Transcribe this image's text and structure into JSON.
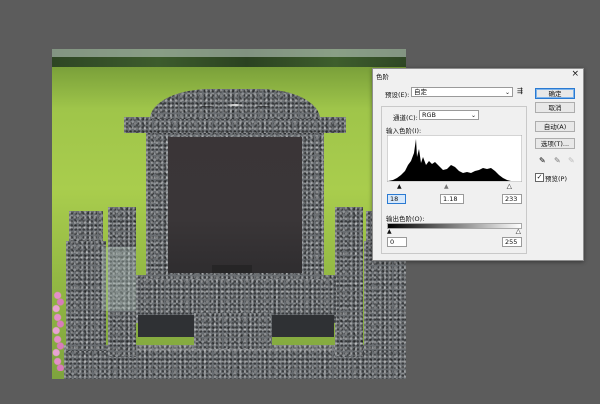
{
  "dialog": {
    "title": "色阶",
    "preset_label": "预设(E):",
    "preset_value": "自定",
    "preset_menu_icon_text": "⇶",
    "channel_label": "通道(C):",
    "channel_value": "RGB",
    "input_levels_label": "输入色阶(I):",
    "input_black": "18",
    "input_gamma": "1.18",
    "input_white": "233",
    "output_levels_label": "输出色阶(O):",
    "output_black": "0",
    "output_white": "255",
    "buttons": {
      "ok": "确定",
      "cancel": "取消",
      "auto": "自动(A)",
      "options": "选项(T)..."
    },
    "preview_label": "预览(P)",
    "preview_checked": true,
    "close_icon": "close-icon",
    "eyedropper_icons": [
      "black-eyedropper-icon",
      "gray-eyedropper-icon",
      "white-eyedropper-icon"
    ]
  },
  "colors": {
    "accent": "#2a7ad2",
    "dialog_bg": "#f0f0f0",
    "workspace_bg": "#5c5c5c"
  }
}
